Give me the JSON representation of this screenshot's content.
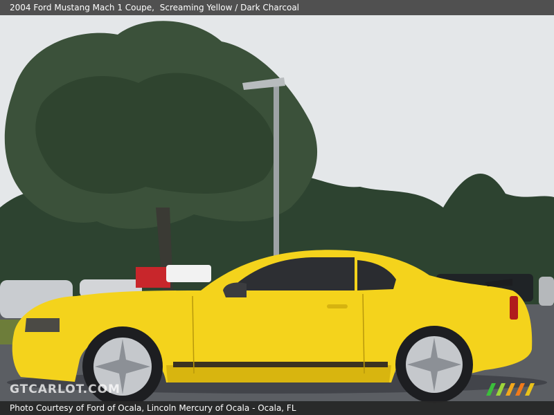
{
  "header": {
    "title": "2004 Ford Mustang Mach 1 Coupe,",
    "color_combo": "Screaming Yellow / Dark Charcoal"
  },
  "footer": {
    "credit": "Photo Courtesy of Ford of Ocala, Lincoln Mercury of Ocala - Ocala, FL"
  },
  "watermark": {
    "text": "GTCARLOT.COM",
    "logo_colors": [
      "#3bbf3b",
      "#9ed63a",
      "#f2a81c",
      "#f07a1a",
      "#e9c21b"
    ]
  },
  "colors": {
    "car_body": "#f4d31c",
    "car_shadow": "#c9a50a",
    "foliage": "#2f4a2b",
    "sky": "#e4e7e9",
    "road": "#5a5d62"
  }
}
